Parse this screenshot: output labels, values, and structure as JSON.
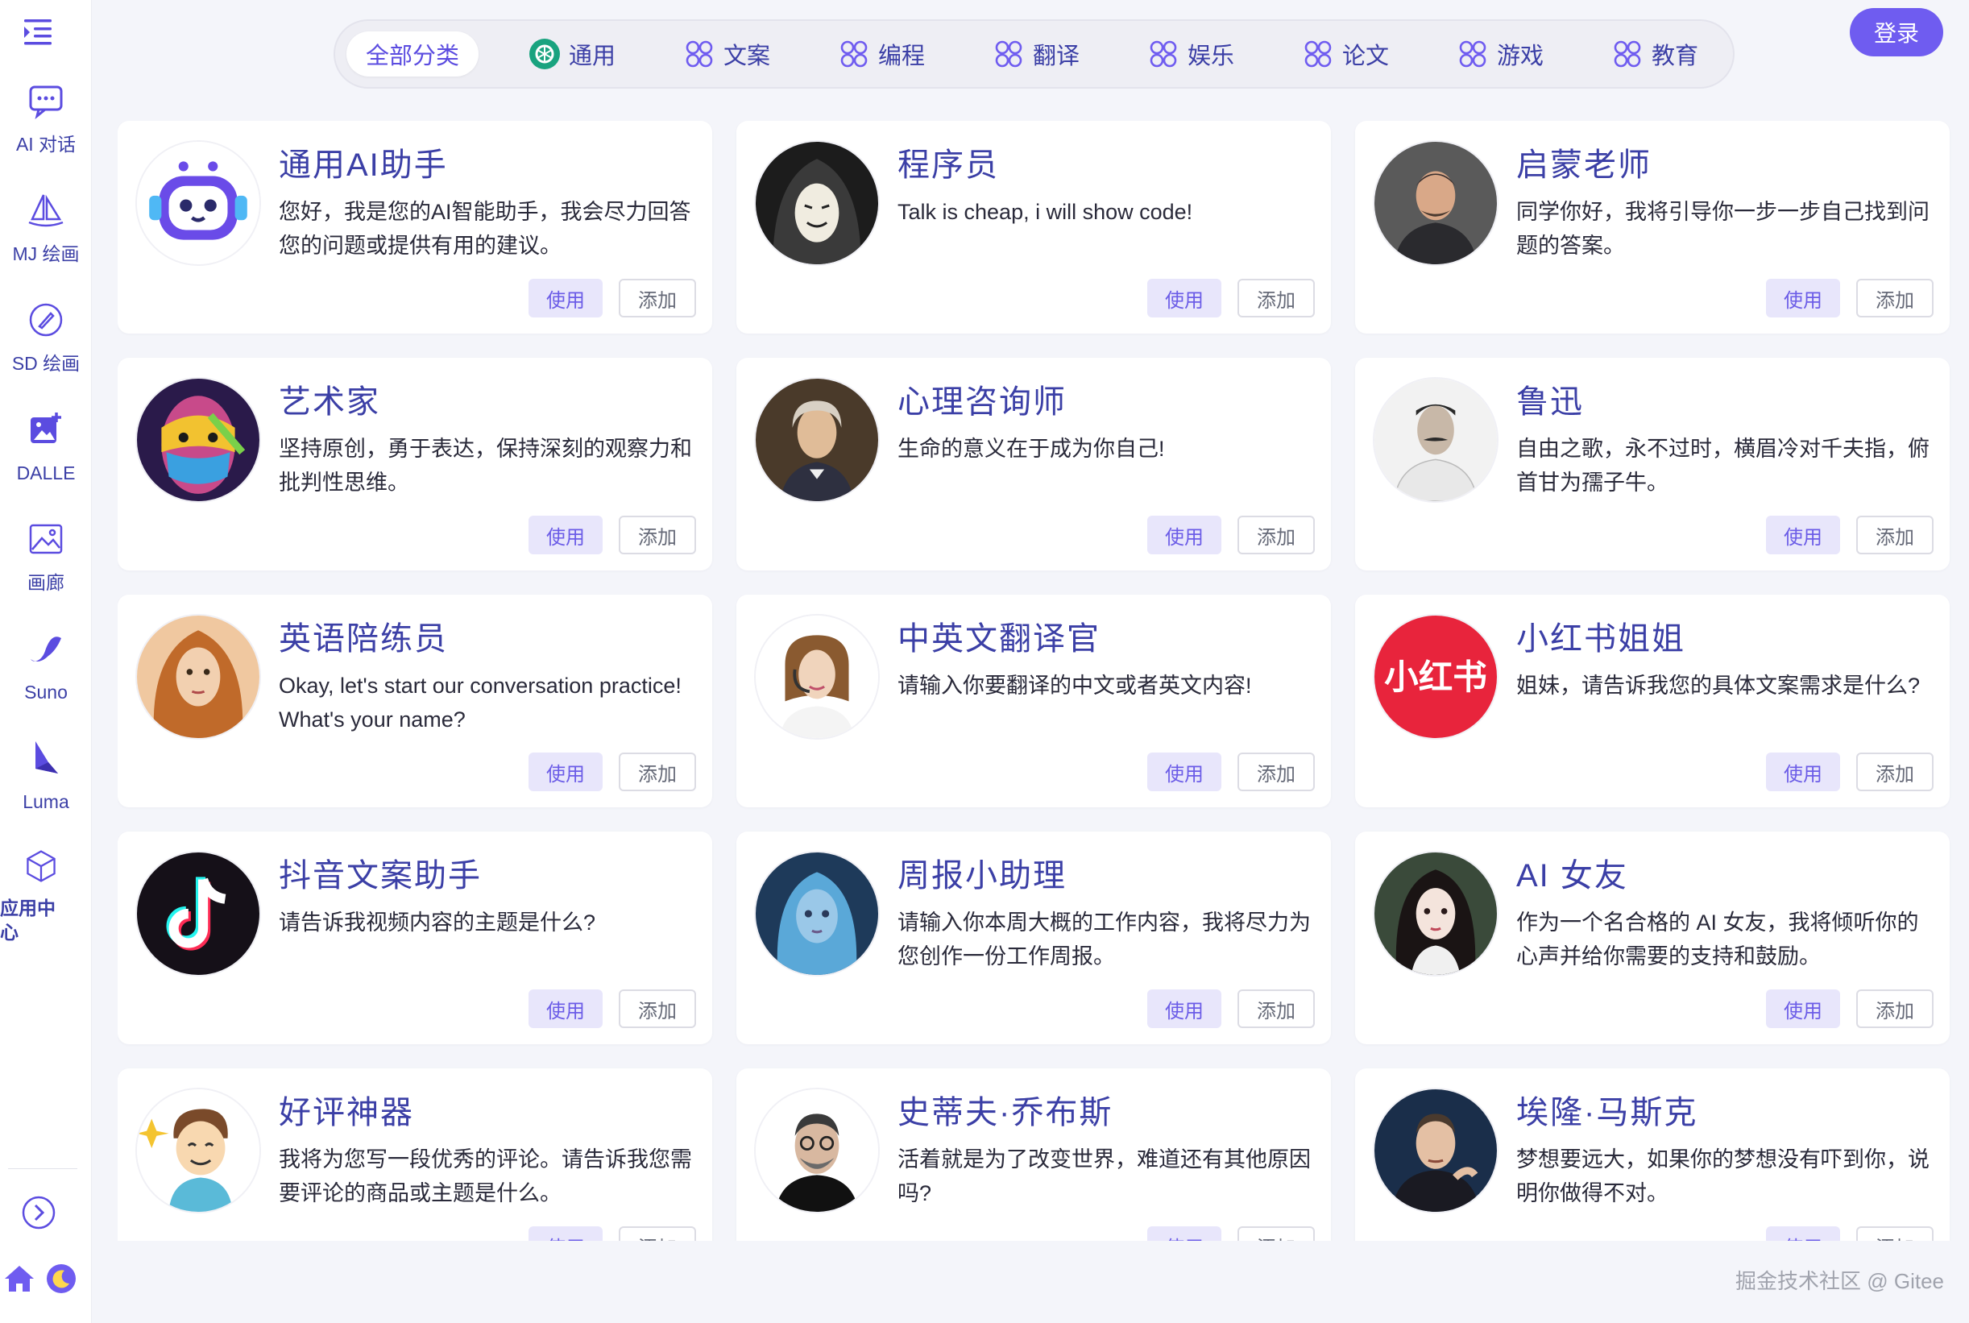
{
  "sidebar": {
    "items": [
      {
        "label": "AI 对话",
        "icon": "chat-icon"
      },
      {
        "label": "MJ 绘画",
        "icon": "sailboat-icon"
      },
      {
        "label": "SD 绘画",
        "icon": "brush-icon"
      },
      {
        "label": "DALLE",
        "icon": "image-plus-icon"
      },
      {
        "label": "画廊",
        "icon": "gallery-icon"
      },
      {
        "label": "Suno",
        "icon": "wave-icon"
      },
      {
        "label": "Luma",
        "icon": "luma-icon"
      },
      {
        "label": "应用中心",
        "icon": "cube-icon"
      }
    ]
  },
  "tabs": [
    {
      "label": "全部分类",
      "active": true
    },
    {
      "label": "通用",
      "icon": "openai-icon"
    },
    {
      "label": "文案",
      "icon": "grid-icon"
    },
    {
      "label": "编程",
      "icon": "grid-icon"
    },
    {
      "label": "翻译",
      "icon": "grid-icon"
    },
    {
      "label": "娱乐",
      "icon": "grid-icon"
    },
    {
      "label": "论文",
      "icon": "grid-icon"
    },
    {
      "label": "游戏",
      "icon": "grid-icon"
    },
    {
      "label": "教育",
      "icon": "grid-icon"
    }
  ],
  "header": {
    "login_label": "登录"
  },
  "buttons": {
    "use": "使用",
    "add": "添加"
  },
  "apps": [
    {
      "title": "通用AI助手",
      "desc": "您好，我是您的AI智能助手，我会尽力回答您的问题或提供有用的建议。",
      "avatar": "robot"
    },
    {
      "title": "程序员",
      "desc": "Talk is cheap, i will show code!",
      "avatar": "hacker"
    },
    {
      "title": "启蒙老师",
      "desc": "同学你好，我将引导你一步一步自己找到问题的答案。",
      "avatar": "teacher"
    },
    {
      "title": "艺术家",
      "desc": "坚持原创，勇于表达，保持深刻的观察力和批判性思维。",
      "avatar": "artist"
    },
    {
      "title": "心理咨询师",
      "desc": "生命的意义在于成为你自己!",
      "avatar": "philosopher"
    },
    {
      "title": "鲁迅",
      "desc": "自由之歌，永不过时，横眉冷对千夫指，俯首甘为孺子牛。",
      "avatar": "luxun"
    },
    {
      "title": "英语陪练员",
      "desc": "Okay, let's start our conversation practice! What's your name?",
      "avatar": "english"
    },
    {
      "title": "中英文翻译官",
      "desc": "请输入你要翻译的中文或者英文内容!",
      "avatar": "translator"
    },
    {
      "title": "小红书姐姐",
      "desc": "姐妹，请告诉我您的具体文案需求是什么?",
      "avatar": "xhs"
    },
    {
      "title": "抖音文案助手",
      "desc": "请告诉我视频内容的主题是什么?",
      "avatar": "douyin"
    },
    {
      "title": "周报小助理",
      "desc": "请输入你本周大概的工作内容，我将尽力为您创作一份工作周报。",
      "avatar": "weekly"
    },
    {
      "title": "AI 女友",
      "desc": "作为一个名合格的 AI 女友，我将倾听你的心声并给你需要的支持和鼓励。",
      "avatar": "girlfriend"
    },
    {
      "title": "好评神器",
      "desc": "我将为您写一段优秀的评论。请告诉我您需要评论的商品或主题是什么。",
      "avatar": "review"
    },
    {
      "title": "史蒂夫·乔布斯",
      "desc": "活着就是为了改变世界，难道还有其他原因吗?",
      "avatar": "jobs"
    },
    {
      "title": "埃隆·马斯克",
      "desc": "梦想要远大，如果你的梦想没有吓到你，说明你做得不对。",
      "avatar": "musk"
    }
  ],
  "watermark": "掘金技术社区 @ Gitee",
  "colors": {
    "accent": "#6f5cf0",
    "title": "#3b3fa6",
    "background": "#f4f5fa"
  }
}
